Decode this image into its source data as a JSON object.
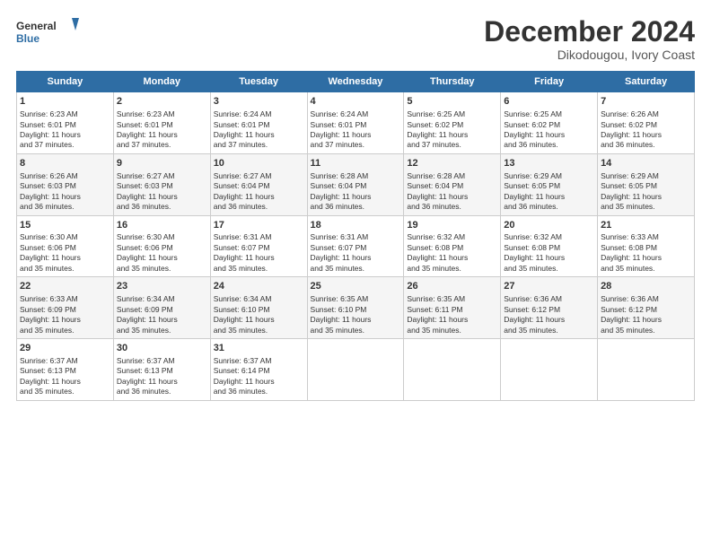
{
  "logo": {
    "line1": "General",
    "line2": "Blue"
  },
  "title": "December 2024",
  "subtitle": "Dikodougou, Ivory Coast",
  "days_header": [
    "Sunday",
    "Monday",
    "Tuesday",
    "Wednesday",
    "Thursday",
    "Friday",
    "Saturday"
  ],
  "weeks": [
    [
      {
        "day": "1",
        "lines": [
          "Sunrise: 6:23 AM",
          "Sunset: 6:01 PM",
          "Daylight: 11 hours",
          "and 37 minutes."
        ]
      },
      {
        "day": "2",
        "lines": [
          "Sunrise: 6:23 AM",
          "Sunset: 6:01 PM",
          "Daylight: 11 hours",
          "and 37 minutes."
        ]
      },
      {
        "day": "3",
        "lines": [
          "Sunrise: 6:24 AM",
          "Sunset: 6:01 PM",
          "Daylight: 11 hours",
          "and 37 minutes."
        ]
      },
      {
        "day": "4",
        "lines": [
          "Sunrise: 6:24 AM",
          "Sunset: 6:01 PM",
          "Daylight: 11 hours",
          "and 37 minutes."
        ]
      },
      {
        "day": "5",
        "lines": [
          "Sunrise: 6:25 AM",
          "Sunset: 6:02 PM",
          "Daylight: 11 hours",
          "and 37 minutes."
        ]
      },
      {
        "day": "6",
        "lines": [
          "Sunrise: 6:25 AM",
          "Sunset: 6:02 PM",
          "Daylight: 11 hours",
          "and 36 minutes."
        ]
      },
      {
        "day": "7",
        "lines": [
          "Sunrise: 6:26 AM",
          "Sunset: 6:02 PM",
          "Daylight: 11 hours",
          "and 36 minutes."
        ]
      }
    ],
    [
      {
        "day": "8",
        "lines": [
          "Sunrise: 6:26 AM",
          "Sunset: 6:03 PM",
          "Daylight: 11 hours",
          "and 36 minutes."
        ]
      },
      {
        "day": "9",
        "lines": [
          "Sunrise: 6:27 AM",
          "Sunset: 6:03 PM",
          "Daylight: 11 hours",
          "and 36 minutes."
        ]
      },
      {
        "day": "10",
        "lines": [
          "Sunrise: 6:27 AM",
          "Sunset: 6:04 PM",
          "Daylight: 11 hours",
          "and 36 minutes."
        ]
      },
      {
        "day": "11",
        "lines": [
          "Sunrise: 6:28 AM",
          "Sunset: 6:04 PM",
          "Daylight: 11 hours",
          "and 36 minutes."
        ]
      },
      {
        "day": "12",
        "lines": [
          "Sunrise: 6:28 AM",
          "Sunset: 6:04 PM",
          "Daylight: 11 hours",
          "and 36 minutes."
        ]
      },
      {
        "day": "13",
        "lines": [
          "Sunrise: 6:29 AM",
          "Sunset: 6:05 PM",
          "Daylight: 11 hours",
          "and 36 minutes."
        ]
      },
      {
        "day": "14",
        "lines": [
          "Sunrise: 6:29 AM",
          "Sunset: 6:05 PM",
          "Daylight: 11 hours",
          "and 35 minutes."
        ]
      }
    ],
    [
      {
        "day": "15",
        "lines": [
          "Sunrise: 6:30 AM",
          "Sunset: 6:06 PM",
          "Daylight: 11 hours",
          "and 35 minutes."
        ]
      },
      {
        "day": "16",
        "lines": [
          "Sunrise: 6:30 AM",
          "Sunset: 6:06 PM",
          "Daylight: 11 hours",
          "and 35 minutes."
        ]
      },
      {
        "day": "17",
        "lines": [
          "Sunrise: 6:31 AM",
          "Sunset: 6:07 PM",
          "Daylight: 11 hours",
          "and 35 minutes."
        ]
      },
      {
        "day": "18",
        "lines": [
          "Sunrise: 6:31 AM",
          "Sunset: 6:07 PM",
          "Daylight: 11 hours",
          "and 35 minutes."
        ]
      },
      {
        "day": "19",
        "lines": [
          "Sunrise: 6:32 AM",
          "Sunset: 6:08 PM",
          "Daylight: 11 hours",
          "and 35 minutes."
        ]
      },
      {
        "day": "20",
        "lines": [
          "Sunrise: 6:32 AM",
          "Sunset: 6:08 PM",
          "Daylight: 11 hours",
          "and 35 minutes."
        ]
      },
      {
        "day": "21",
        "lines": [
          "Sunrise: 6:33 AM",
          "Sunset: 6:08 PM",
          "Daylight: 11 hours",
          "and 35 minutes."
        ]
      }
    ],
    [
      {
        "day": "22",
        "lines": [
          "Sunrise: 6:33 AM",
          "Sunset: 6:09 PM",
          "Daylight: 11 hours",
          "and 35 minutes."
        ]
      },
      {
        "day": "23",
        "lines": [
          "Sunrise: 6:34 AM",
          "Sunset: 6:09 PM",
          "Daylight: 11 hours",
          "and 35 minutes."
        ]
      },
      {
        "day": "24",
        "lines": [
          "Sunrise: 6:34 AM",
          "Sunset: 6:10 PM",
          "Daylight: 11 hours",
          "and 35 minutes."
        ]
      },
      {
        "day": "25",
        "lines": [
          "Sunrise: 6:35 AM",
          "Sunset: 6:10 PM",
          "Daylight: 11 hours",
          "and 35 minutes."
        ]
      },
      {
        "day": "26",
        "lines": [
          "Sunrise: 6:35 AM",
          "Sunset: 6:11 PM",
          "Daylight: 11 hours",
          "and 35 minutes."
        ]
      },
      {
        "day": "27",
        "lines": [
          "Sunrise: 6:36 AM",
          "Sunset: 6:12 PM",
          "Daylight: 11 hours",
          "and 35 minutes."
        ]
      },
      {
        "day": "28",
        "lines": [
          "Sunrise: 6:36 AM",
          "Sunset: 6:12 PM",
          "Daylight: 11 hours",
          "and 35 minutes."
        ]
      }
    ],
    [
      {
        "day": "29",
        "lines": [
          "Sunrise: 6:37 AM",
          "Sunset: 6:13 PM",
          "Daylight: 11 hours",
          "and 35 minutes."
        ]
      },
      {
        "day": "30",
        "lines": [
          "Sunrise: 6:37 AM",
          "Sunset: 6:13 PM",
          "Daylight: 11 hours",
          "and 36 minutes."
        ]
      },
      {
        "day": "31",
        "lines": [
          "Sunrise: 6:37 AM",
          "Sunset: 6:14 PM",
          "Daylight: 11 hours",
          "and 36 minutes."
        ]
      },
      {
        "day": "",
        "lines": []
      },
      {
        "day": "",
        "lines": []
      },
      {
        "day": "",
        "lines": []
      },
      {
        "day": "",
        "lines": []
      }
    ]
  ]
}
